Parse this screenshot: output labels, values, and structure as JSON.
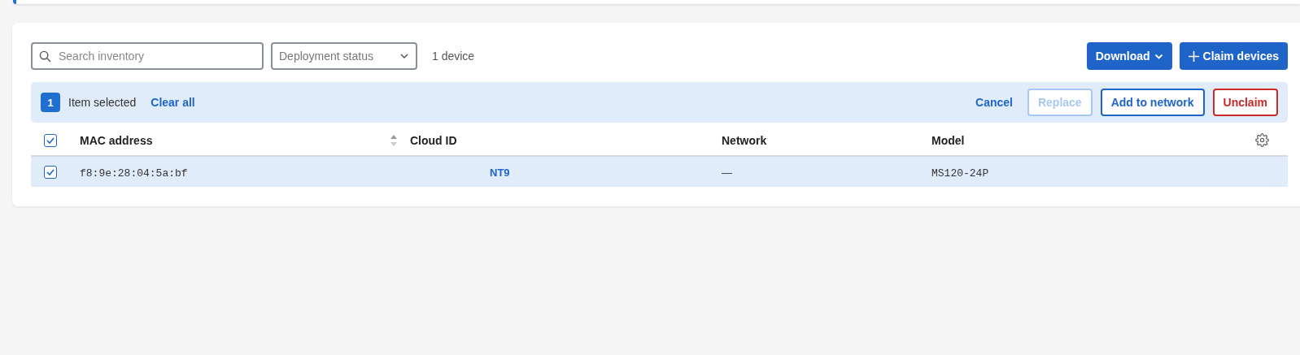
{
  "toolbar": {
    "search": {
      "placeholder": "Search inventory"
    },
    "status_filter": {
      "label": "Deployment status"
    },
    "count": "1 device",
    "buttons": [
      {
        "label": "Download",
        "kind": "menu"
      },
      {
        "label": "Claim devices",
        "kind": "add"
      }
    ]
  },
  "selection_bar": {
    "count": "1",
    "label": "Item selected",
    "clear": "Clear all",
    "actions": [
      {
        "label": "Cancel",
        "kind": "link",
        "disabled": false
      },
      {
        "label": "Replace",
        "kind": "outline",
        "disabled": true
      },
      {
        "label": "Add to network",
        "kind": "outline",
        "disabled": false
      },
      {
        "label": "Unclaim",
        "kind": "danger",
        "disabled": false
      }
    ]
  },
  "table": {
    "all_checked": true,
    "columns": [
      {
        "label": "MAC address",
        "sortable": true
      },
      {
        "label": "Cloud ID",
        "sortable": false
      },
      {
        "label": "Network",
        "sortable": false
      },
      {
        "label": "Model",
        "sortable": false
      }
    ],
    "rows": [
      {
        "selected": true,
        "cells": [
          "f8:9e:28:04:5a:bf",
          "NT9",
          "—",
          "MS120-24P"
        ]
      }
    ]
  }
}
